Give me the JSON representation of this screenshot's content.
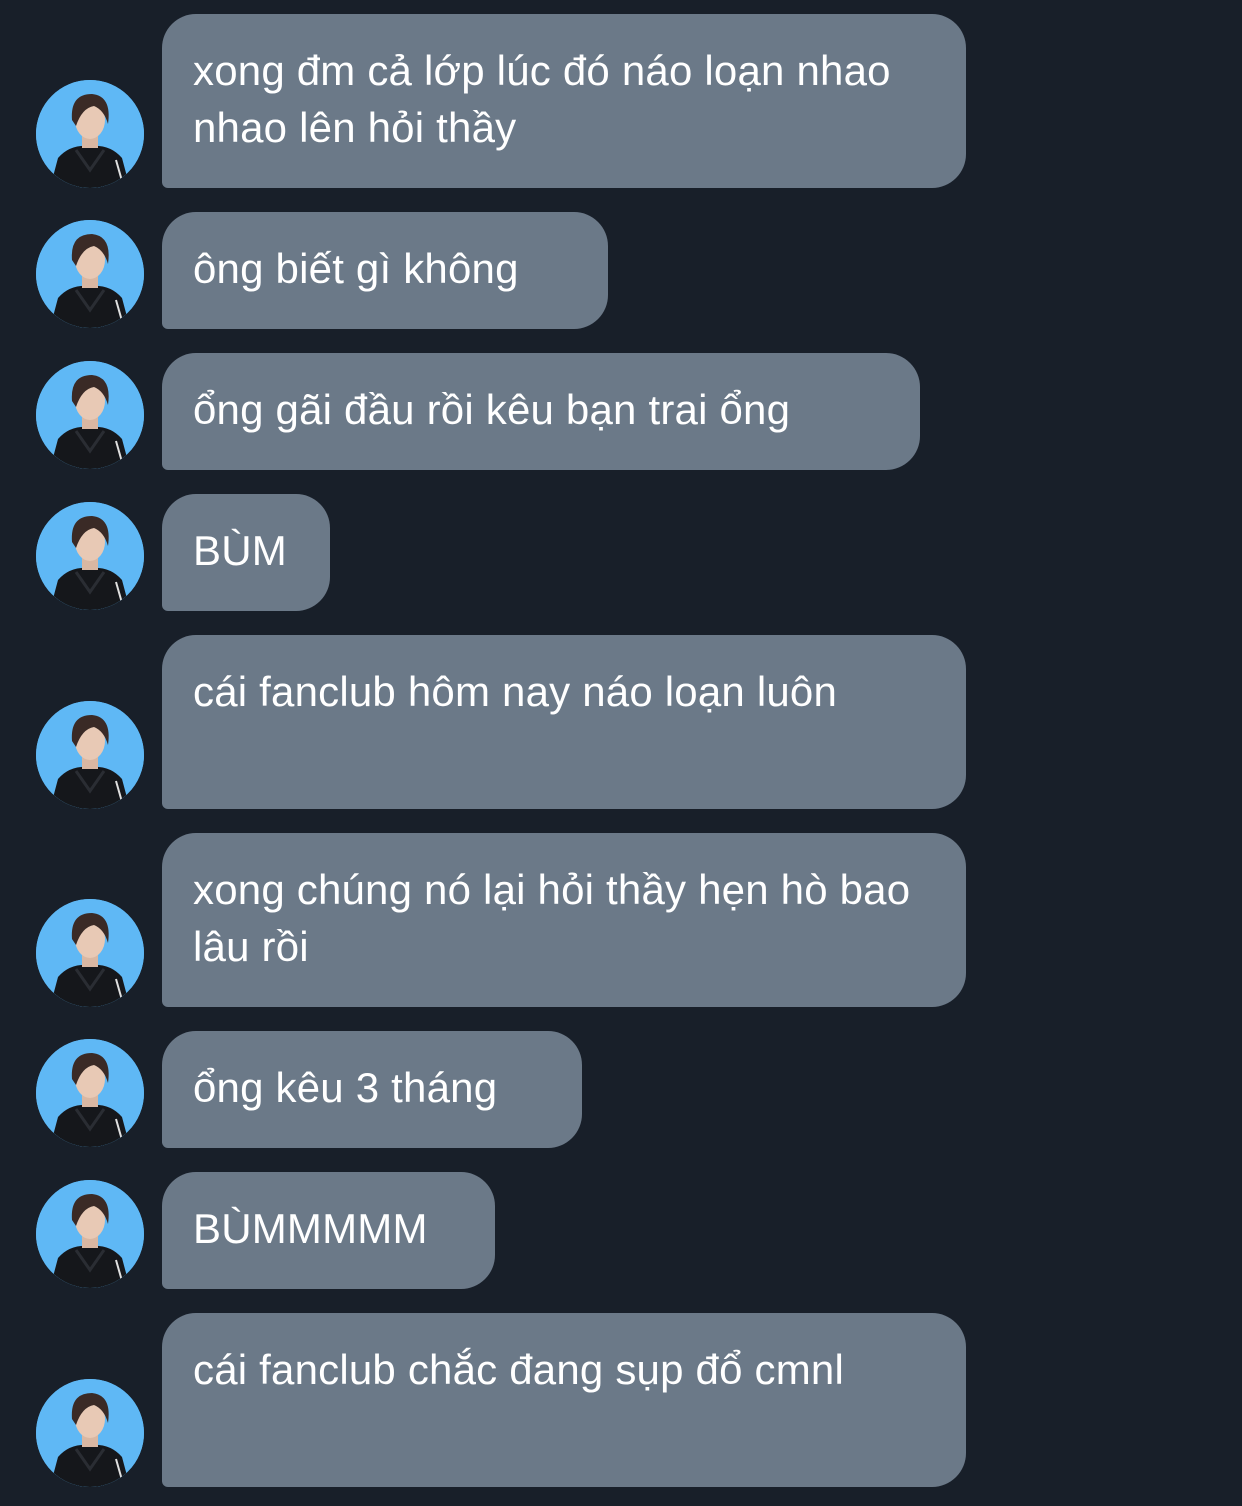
{
  "conversation": {
    "avatar_icon": "user-avatar-photo",
    "colors": {
      "background": "#181f29",
      "bubble": "#6b7988",
      "text": "#ffffff",
      "avatar_bg": "#5fb8f5"
    },
    "messages": [
      {
        "text": "xong đm cả lớp lúc đó náo loạn nhao nhao lên hỏi thầy"
      },
      {
        "text": "ông biết gì không"
      },
      {
        "text": "ổng gãi đầu rồi kêu bạn trai ổng"
      },
      {
        "text": "BÙM"
      },
      {
        "text": "cái fanclub hôm nay náo loạn luôn"
      },
      {
        "text": "xong chúng nó lại hỏi thầy hẹn hò bao lâu rồi"
      },
      {
        "text": "ổng kêu 3 tháng"
      },
      {
        "text": "BÙMMMMM"
      },
      {
        "text": "cái fanclub chắc đang sụp đổ cmnl"
      }
    ]
  }
}
